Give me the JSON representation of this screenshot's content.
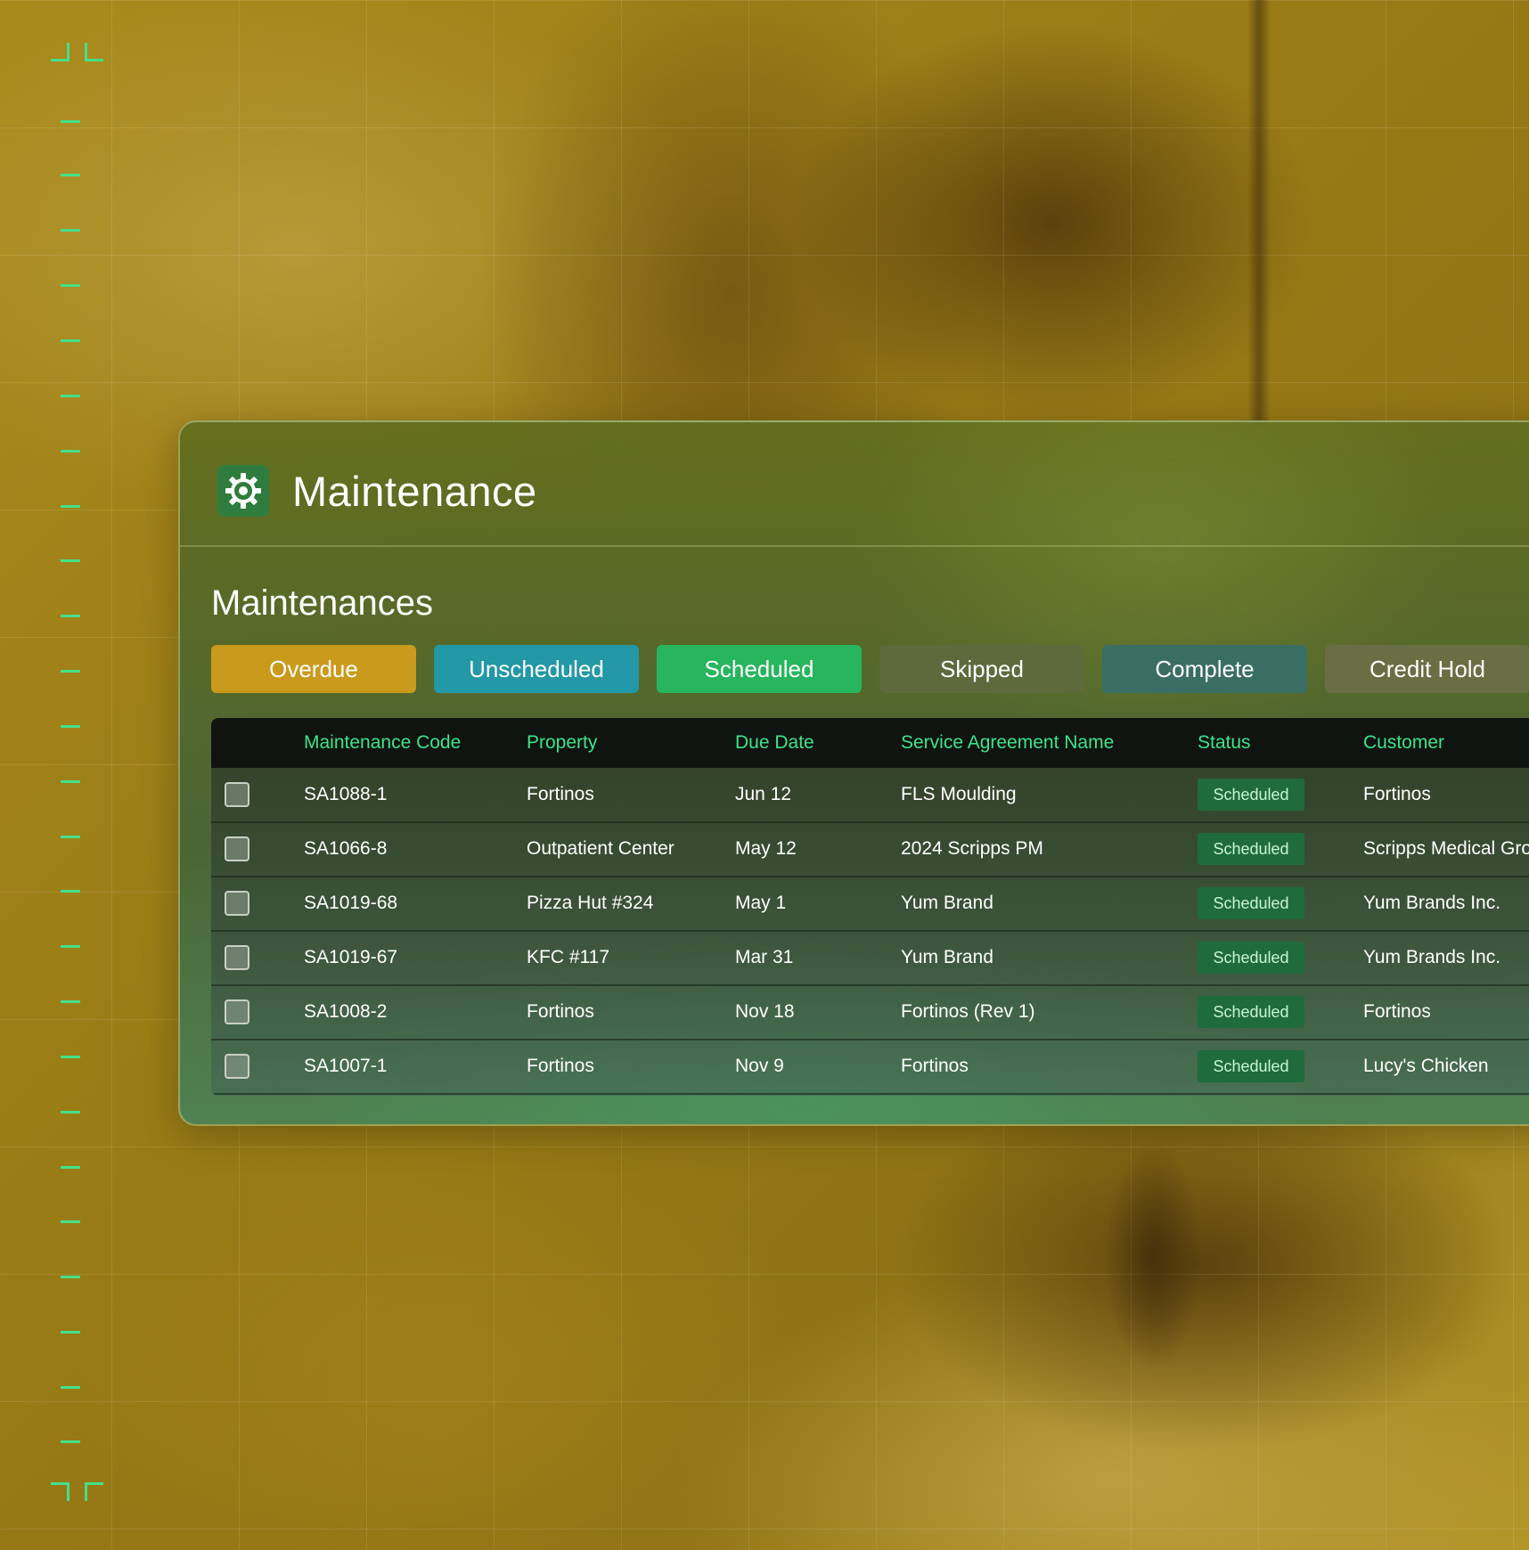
{
  "app": {
    "title": "Maintenance",
    "icon": "gear-icon"
  },
  "section": {
    "title": "Maintenances"
  },
  "filters": [
    {
      "label": "Overdue",
      "color": "#c99a1c"
    },
    {
      "label": "Unscheduled",
      "color": "#2398a6"
    },
    {
      "label": "Scheduled",
      "color": "#27b55e"
    },
    {
      "label": "Skipped",
      "color": "#5d6a3c"
    },
    {
      "label": "Complete",
      "color": "#3a6e64"
    },
    {
      "label": "Credit Hold",
      "color": "#6a6e44"
    }
  ],
  "table": {
    "columns": [
      "Maintenance Code",
      "Property",
      "Due Date",
      "Service Agreement Name",
      "Status",
      "Customer"
    ],
    "rows": [
      {
        "code": "SA1088-1",
        "property": "Fortinos",
        "due": "Jun 12",
        "agreement": "FLS Moulding",
        "status": "Scheduled",
        "customer": "Fortinos"
      },
      {
        "code": "SA1066-8",
        "property": "Outpatient Center",
        "due": "May 12",
        "agreement": "2024 Scripps PM",
        "status": "Scheduled",
        "customer": "Scripps Medical Gro"
      },
      {
        "code": "SA1019-68",
        "property": "Pizza Hut #324",
        "due": "May 1",
        "agreement": "Yum Brand",
        "status": "Scheduled",
        "customer": "Yum Brands Inc."
      },
      {
        "code": "SA1019-67",
        "property": "KFC #117",
        "due": "Mar 31",
        "agreement": "Yum Brand",
        "status": "Scheduled",
        "customer": "Yum Brands Inc."
      },
      {
        "code": "SA1008-2",
        "property": "Fortinos",
        "due": "Nov 18",
        "agreement": "Fortinos (Rev 1)",
        "status": "Scheduled",
        "customer": "Fortinos"
      },
      {
        "code": "SA1007-1",
        "property": "Fortinos",
        "due": "Nov 9",
        "agreement": "Fortinos",
        "status": "Scheduled",
        "customer": "Lucy's Chicken"
      }
    ]
  },
  "colors": {
    "accent": "#3ee38a",
    "status_badge": "#1f6b3c"
  }
}
